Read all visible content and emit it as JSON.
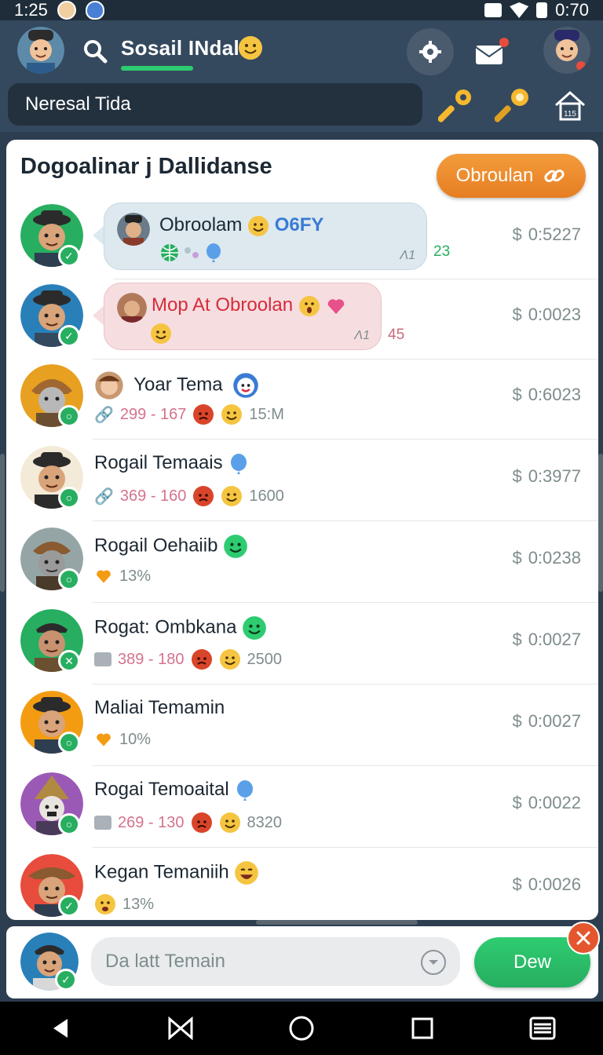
{
  "status_bar": {
    "time": "1:25",
    "battery": "0:70"
  },
  "header": {
    "title": "Sosail INdal",
    "search_text": "Neresal Tida"
  },
  "list": {
    "title": "Dogoalinar j Dallidanse",
    "primary_button": "Obroulan"
  },
  "rows": [
    {
      "type": "bubble",
      "bubble_style": "blue",
      "text": "Obroolam",
      "tag": "O6FY",
      "tick": "Λ1",
      "count": "23",
      "price": "0:5227",
      "status": "check",
      "avatar_color": "#27ae60"
    },
    {
      "type": "bubble",
      "bubble_style": "pink",
      "text": "Mop At Obroolan",
      "tick": "Λ1",
      "count": "45",
      "price": "0:0023",
      "status": "check",
      "avatar_color": "#2980b9"
    },
    {
      "type": "item",
      "name": "Yoar Tema",
      "range": "299 - 167",
      "extra": "15:M",
      "price": "0:6023",
      "status": "ring",
      "avatar_color": "#e8a020"
    },
    {
      "type": "item",
      "name": "Rogail Temaais",
      "range": "369 - 160",
      "extra": "1600",
      "price": "0:3977",
      "status": "ring",
      "avatar_color": "#f4ead8"
    },
    {
      "type": "item",
      "name": "Rogail Oehaiib",
      "percent": "13%",
      "price": "0:0238",
      "status": "ring",
      "avatar_color": "#95a5a6"
    },
    {
      "type": "item",
      "name": "Rogat: Ombkana",
      "range": "389 - 180",
      "extra": "2500",
      "price": "0:0027",
      "status": "x",
      "avatar_color": "#27ae60"
    },
    {
      "type": "item",
      "name": "Maliai Temamin",
      "percent": "10%",
      "price": "0:0027",
      "status": "ring",
      "avatar_color": "#f39c12"
    },
    {
      "type": "item",
      "name": "Rogai Temoaital",
      "range": "269 - 130",
      "extra": "8320",
      "price": "0:0022",
      "status": "ring",
      "avatar_color": "#9b59b6"
    },
    {
      "type": "item",
      "name": "Kegan Temaniih",
      "percent": "13%",
      "price": "0:0026",
      "status": "check",
      "avatar_color": "#e74c3c"
    }
  ],
  "currency_symbol": "$",
  "composer": {
    "placeholder": "Da latt Temain",
    "send_label": "Dew"
  },
  "colors": {
    "accent_orange": "#e67e22",
    "accent_green": "#27ae60",
    "header_bg": "#34495e",
    "tag_blue": "#3a7bd5"
  },
  "icons": [
    "search-icon",
    "gear-icon",
    "mail-icon",
    "key-icon",
    "home-icon",
    "link-icon",
    "chevron-down-icon",
    "close-icon",
    "back-icon",
    "recent-icon",
    "home-circle-icon",
    "square-icon",
    "menu-icon"
  ]
}
